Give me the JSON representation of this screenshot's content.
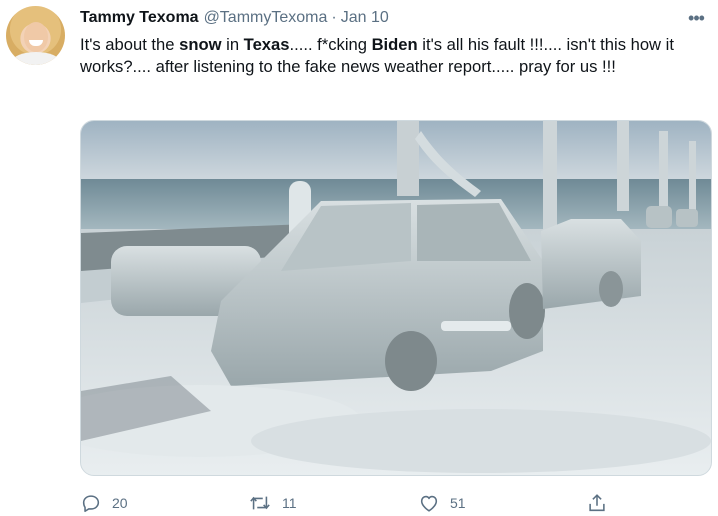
{
  "tweet": {
    "author": {
      "display_name": "Tammy Texoma",
      "handle": "@TammyTexoma",
      "separator": "·",
      "date": "Jan 10"
    },
    "more_icon": "more-horizontal-icon",
    "text": {
      "seg1": "It's about the ",
      "seg2": "snow",
      "seg3": " in ",
      "seg4": "Texas",
      "seg5": "..... f*cking ",
      "seg6": "Biden",
      "seg7": " it's all his fault !!!.... isn't this how it works?.... after listening to the fake news weather report..... pray for us !!!"
    },
    "media": {
      "type": "photo",
      "subject": "ice-covered cars and trees along a lakeside road"
    },
    "actions": {
      "reply": {
        "icon": "reply-icon",
        "count": "20"
      },
      "retweet": {
        "icon": "retweet-icon",
        "count": "11"
      },
      "like": {
        "icon": "heart-icon",
        "count": "51"
      },
      "share": {
        "icon": "share-icon"
      }
    },
    "colors": {
      "text": "#0f1419",
      "secondary": "#5b7083",
      "border": "#cfd9de"
    }
  }
}
